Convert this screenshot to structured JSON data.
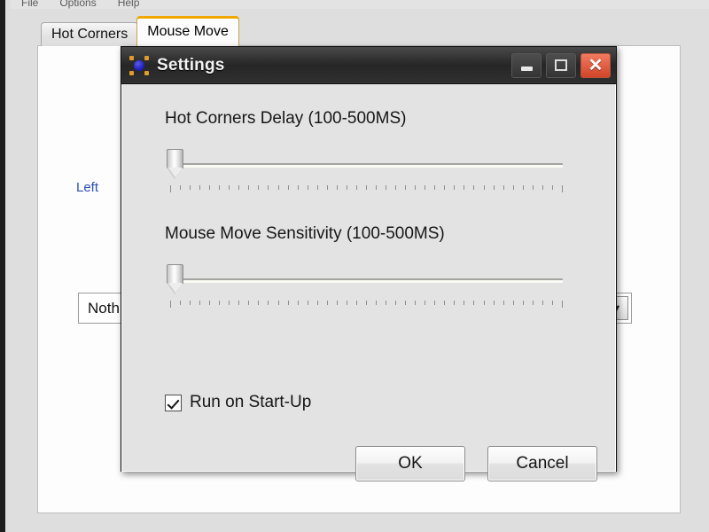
{
  "app": {
    "menu": [
      {
        "label": "File"
      },
      {
        "label": "Options"
      },
      {
        "label": "Help"
      }
    ],
    "tabs": [
      {
        "label": "Hot Corners",
        "active": false
      },
      {
        "label": "Mouse Move",
        "active": true
      }
    ],
    "group_left": {
      "legend": "Left",
      "combo_value": "Nothi",
      "combo_arrow_icon": "chevron-down-icon"
    },
    "accent_color": "#f0a800",
    "legend_color": "#2b50b4"
  },
  "dialog": {
    "title": "Settings",
    "icon": "hot-corners-app-icon",
    "window_controls": {
      "minimize": "minimize-icon",
      "maximize": "maximize-icon",
      "close": "close-icon",
      "close_color": "#d2452a"
    },
    "hot_corners_delay": {
      "label": "Hot Corners Delay (100-500MS)",
      "min": 100,
      "max": 500,
      "value": 100,
      "ticks": 41
    },
    "mouse_move_sensitivity": {
      "label": "Mouse Move Sensitivity (100-500MS)",
      "min": 100,
      "max": 500,
      "value": 100,
      "ticks": 41
    },
    "run_on_startup": {
      "label": "Run on Start-Up",
      "checked": true
    },
    "buttons": {
      "ok": "OK",
      "cancel": "Cancel"
    }
  }
}
